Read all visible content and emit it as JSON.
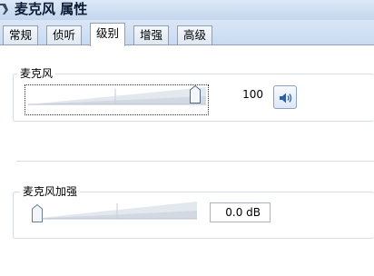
{
  "window": {
    "title": "麦克风 属性"
  },
  "tabs": [
    {
      "label": "常规",
      "active": false
    },
    {
      "label": "侦听",
      "active": false
    },
    {
      "label": "级别",
      "active": true
    },
    {
      "label": "增强",
      "active": false
    },
    {
      "label": "高级",
      "active": false
    }
  ],
  "microphone": {
    "label": "麦克风",
    "level": 100,
    "level_text": "100",
    "max": 100
  },
  "boost": {
    "label": "麦克风加强",
    "value_db": 0.0,
    "value_text": "0.0 dB"
  },
  "icons": {
    "mute": "speaker-icon",
    "window": "microphone-icon"
  }
}
